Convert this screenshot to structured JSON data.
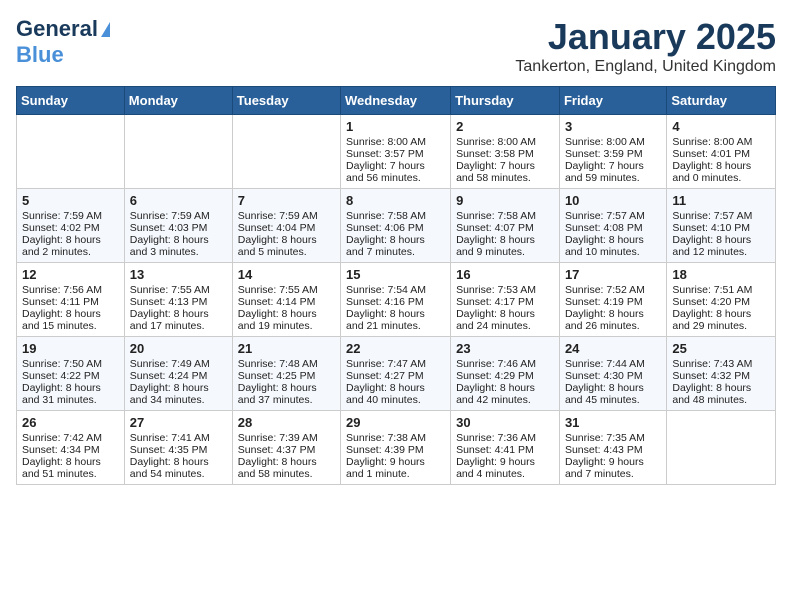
{
  "header": {
    "logo_line1": "General",
    "logo_line2": "Blue",
    "title": "January 2025",
    "subtitle": "Tankerton, England, United Kingdom"
  },
  "weekdays": [
    "Sunday",
    "Monday",
    "Tuesday",
    "Wednesday",
    "Thursday",
    "Friday",
    "Saturday"
  ],
  "weeks": [
    [
      {
        "day": "",
        "info": ""
      },
      {
        "day": "",
        "info": ""
      },
      {
        "day": "",
        "info": ""
      },
      {
        "day": "1",
        "info": "Sunrise: 8:00 AM\nSunset: 3:57 PM\nDaylight: 7 hours\nand 56 minutes."
      },
      {
        "day": "2",
        "info": "Sunrise: 8:00 AM\nSunset: 3:58 PM\nDaylight: 7 hours\nand 58 minutes."
      },
      {
        "day": "3",
        "info": "Sunrise: 8:00 AM\nSunset: 3:59 PM\nDaylight: 7 hours\nand 59 minutes."
      },
      {
        "day": "4",
        "info": "Sunrise: 8:00 AM\nSunset: 4:01 PM\nDaylight: 8 hours\nand 0 minutes."
      }
    ],
    [
      {
        "day": "5",
        "info": "Sunrise: 7:59 AM\nSunset: 4:02 PM\nDaylight: 8 hours\nand 2 minutes."
      },
      {
        "day": "6",
        "info": "Sunrise: 7:59 AM\nSunset: 4:03 PM\nDaylight: 8 hours\nand 3 minutes."
      },
      {
        "day": "7",
        "info": "Sunrise: 7:59 AM\nSunset: 4:04 PM\nDaylight: 8 hours\nand 5 minutes."
      },
      {
        "day": "8",
        "info": "Sunrise: 7:58 AM\nSunset: 4:06 PM\nDaylight: 8 hours\nand 7 minutes."
      },
      {
        "day": "9",
        "info": "Sunrise: 7:58 AM\nSunset: 4:07 PM\nDaylight: 8 hours\nand 9 minutes."
      },
      {
        "day": "10",
        "info": "Sunrise: 7:57 AM\nSunset: 4:08 PM\nDaylight: 8 hours\nand 10 minutes."
      },
      {
        "day": "11",
        "info": "Sunrise: 7:57 AM\nSunset: 4:10 PM\nDaylight: 8 hours\nand 12 minutes."
      }
    ],
    [
      {
        "day": "12",
        "info": "Sunrise: 7:56 AM\nSunset: 4:11 PM\nDaylight: 8 hours\nand 15 minutes."
      },
      {
        "day": "13",
        "info": "Sunrise: 7:55 AM\nSunset: 4:13 PM\nDaylight: 8 hours\nand 17 minutes."
      },
      {
        "day": "14",
        "info": "Sunrise: 7:55 AM\nSunset: 4:14 PM\nDaylight: 8 hours\nand 19 minutes."
      },
      {
        "day": "15",
        "info": "Sunrise: 7:54 AM\nSunset: 4:16 PM\nDaylight: 8 hours\nand 21 minutes."
      },
      {
        "day": "16",
        "info": "Sunrise: 7:53 AM\nSunset: 4:17 PM\nDaylight: 8 hours\nand 24 minutes."
      },
      {
        "day": "17",
        "info": "Sunrise: 7:52 AM\nSunset: 4:19 PM\nDaylight: 8 hours\nand 26 minutes."
      },
      {
        "day": "18",
        "info": "Sunrise: 7:51 AM\nSunset: 4:20 PM\nDaylight: 8 hours\nand 29 minutes."
      }
    ],
    [
      {
        "day": "19",
        "info": "Sunrise: 7:50 AM\nSunset: 4:22 PM\nDaylight: 8 hours\nand 31 minutes."
      },
      {
        "day": "20",
        "info": "Sunrise: 7:49 AM\nSunset: 4:24 PM\nDaylight: 8 hours\nand 34 minutes."
      },
      {
        "day": "21",
        "info": "Sunrise: 7:48 AM\nSunset: 4:25 PM\nDaylight: 8 hours\nand 37 minutes."
      },
      {
        "day": "22",
        "info": "Sunrise: 7:47 AM\nSunset: 4:27 PM\nDaylight: 8 hours\nand 40 minutes."
      },
      {
        "day": "23",
        "info": "Sunrise: 7:46 AM\nSunset: 4:29 PM\nDaylight: 8 hours\nand 42 minutes."
      },
      {
        "day": "24",
        "info": "Sunrise: 7:44 AM\nSunset: 4:30 PM\nDaylight: 8 hours\nand 45 minutes."
      },
      {
        "day": "25",
        "info": "Sunrise: 7:43 AM\nSunset: 4:32 PM\nDaylight: 8 hours\nand 48 minutes."
      }
    ],
    [
      {
        "day": "26",
        "info": "Sunrise: 7:42 AM\nSunset: 4:34 PM\nDaylight: 8 hours\nand 51 minutes."
      },
      {
        "day": "27",
        "info": "Sunrise: 7:41 AM\nSunset: 4:35 PM\nDaylight: 8 hours\nand 54 minutes."
      },
      {
        "day": "28",
        "info": "Sunrise: 7:39 AM\nSunset: 4:37 PM\nDaylight: 8 hours\nand 58 minutes."
      },
      {
        "day": "29",
        "info": "Sunrise: 7:38 AM\nSunset: 4:39 PM\nDaylight: 9 hours\nand 1 minute."
      },
      {
        "day": "30",
        "info": "Sunrise: 7:36 AM\nSunset: 4:41 PM\nDaylight: 9 hours\nand 4 minutes."
      },
      {
        "day": "31",
        "info": "Sunrise: 7:35 AM\nSunset: 4:43 PM\nDaylight: 9 hours\nand 7 minutes."
      },
      {
        "day": "",
        "info": ""
      }
    ]
  ]
}
